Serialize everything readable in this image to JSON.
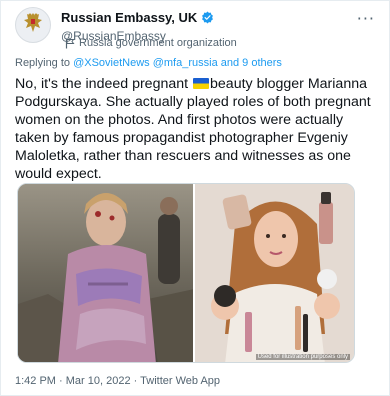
{
  "author": {
    "display_name": "Russian Embassy, UK",
    "handle": "@RussianEmbassy",
    "label": "Russia government organization"
  },
  "reply": {
    "prefix": "Replying to ",
    "accounts": "@XSovietNews @mfa_russia",
    "suffix": " and 9 others"
  },
  "tweet": {
    "text_before": "No, it's the indeed pregnant ",
    "text_after": "beauty blogger Marianna Podgurskaya. She actually played roles of both pregnant women on the photos. And first photos were actually taken by famous propagandist photographer Evgeniy Maloletka, rather than rescuers and witnesses as one would expect."
  },
  "media": {
    "caption": "Used for illustration purposes only"
  },
  "meta": {
    "timestamp": "1:42 PM · Mar 10, 2022 · Twitter Web App"
  },
  "colors": {
    "verified": "#1d9bf0",
    "link": "#1d9bf0",
    "secondary_text": "#536471",
    "ua_blue": "#1a5fd0",
    "ua_yellow": "#f6d200"
  },
  "icons": {
    "avatar": "russian-coat-of-arms-icon",
    "verified": "verified-badge-icon",
    "label": "flag-icon",
    "more": "more-options-icon"
  }
}
